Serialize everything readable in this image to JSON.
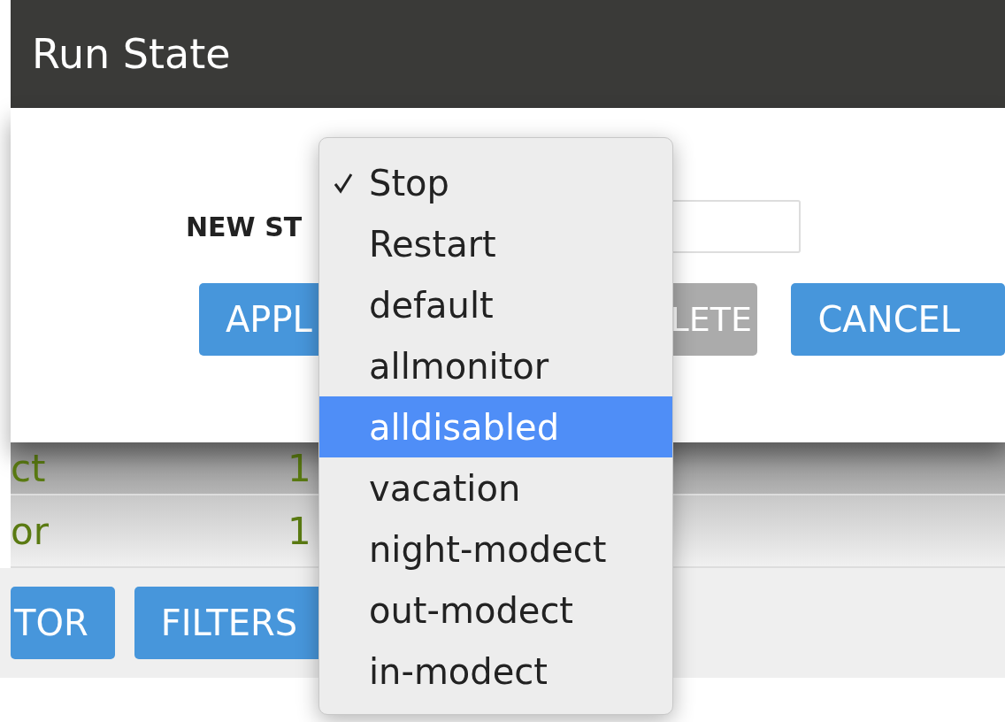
{
  "dialog": {
    "title": "Run State",
    "field_label": "NEW ST",
    "buttons": [
      {
        "label": "APPL",
        "kind": "primary"
      },
      {
        "label": "LETE",
        "kind": "disabled"
      },
      {
        "label": "CANCEL",
        "kind": "primary"
      }
    ]
  },
  "background_rows": [
    {
      "column_1": "ct",
      "column_2": "1",
      "shaded": true
    },
    {
      "column_1": "or",
      "column_2": "1",
      "shaded": false
    }
  ],
  "background_buttons": [
    "TOR",
    "FILTERS"
  ],
  "state_menu": {
    "options": [
      {
        "label": "Stop",
        "checked": true,
        "selected": false
      },
      {
        "label": "Restart",
        "checked": false,
        "selected": false
      },
      {
        "label": "default",
        "checked": false,
        "selected": false
      },
      {
        "label": "allmonitor",
        "checked": false,
        "selected": false
      },
      {
        "label": "alldisabled",
        "checked": false,
        "selected": true
      },
      {
        "label": "vacation",
        "checked": false,
        "selected": false
      },
      {
        "label": "night-modect",
        "checked": false,
        "selected": false
      },
      {
        "label": "out-modect",
        "checked": false,
        "selected": false
      },
      {
        "label": "in-modect",
        "checked": false,
        "selected": false
      }
    ]
  }
}
